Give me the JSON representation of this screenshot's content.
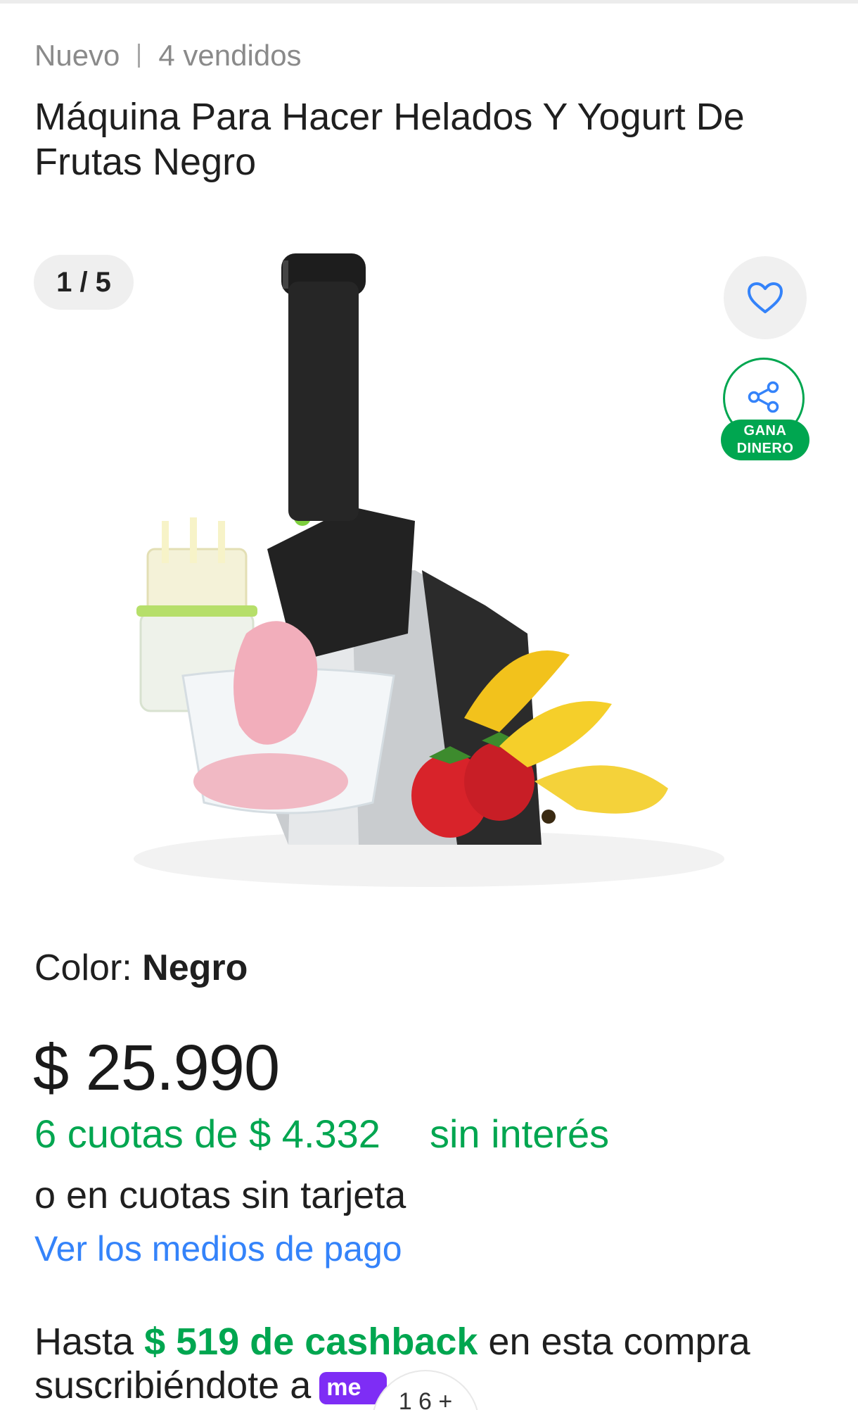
{
  "header": {
    "condition": "Nuevo",
    "sold": "4 vendidos",
    "title": "Máquina Para Hacer Helados Y Yogurt De Frutas Negro"
  },
  "gallery": {
    "counter": "1 / 5",
    "favorite_icon": "heart-outline-icon",
    "share_icon": "share-icon",
    "share_badge_line1": "GANA",
    "share_badge_line2": "DINERO",
    "accent_color": "#00a650"
  },
  "variant": {
    "label": "Color: ",
    "value": "Negro"
  },
  "pricing": {
    "price": "$ 25.990",
    "installments": "6 cuotas de $ 4.332",
    "interest": "sin interés",
    "alt_payment": "o en cuotas sin tarjeta",
    "payment_link": "Ver los medios de pago",
    "price_color": "#1a1a1a",
    "link_color": "#3483fa"
  },
  "cashback": {
    "prefix": "Hasta ",
    "amount": "$ 519 de cashback",
    "suffix": " en esta compra",
    "line2": "suscribiéndote a",
    "logo_text": "me",
    "peek_text": "1 6 +",
    "brand_color": "#7e2df5"
  }
}
